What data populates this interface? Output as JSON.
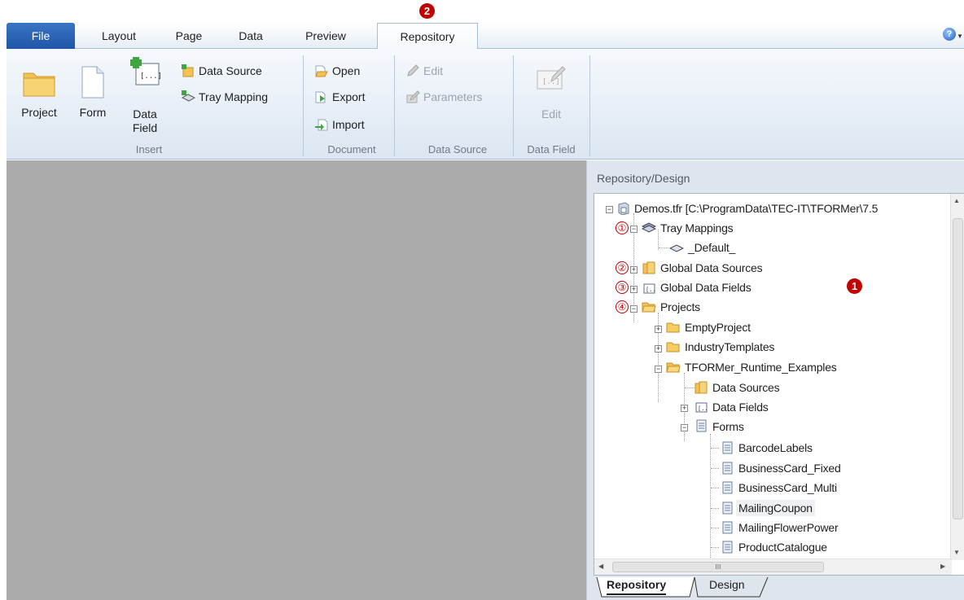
{
  "ribbon": {
    "tabs": [
      "File",
      "Layout",
      "Page",
      "Data",
      "Preview",
      "Repository"
    ],
    "active_tab": "Repository",
    "groups": {
      "insert": {
        "label": "Insert",
        "project": "Project",
        "form": "Form",
        "data_field": "Data\nField",
        "data_source": "Data Source",
        "tray_mapping": "Tray Mapping"
      },
      "document": {
        "label": "Document",
        "open": "Open",
        "export": "Export",
        "import": "Import"
      },
      "data_source": {
        "label": "Data Source",
        "edit": "Edit",
        "parameters": "Parameters"
      },
      "data_field": {
        "label": "Data Field",
        "edit": "Edit"
      }
    }
  },
  "panel": {
    "title": "Repository/Design",
    "tree": {
      "root": "Demos.tfr [C:\\ProgramData\\TEC-IT\\TFORMer\\7.5",
      "tray_mappings": "Tray Mappings",
      "default": "_Default_",
      "global_data_sources": "Global Data Sources",
      "global_data_fields": "Global Data Fields",
      "projects": "Projects",
      "empty_project": "EmptyProject",
      "industry_templates": "IndustryTemplates",
      "runtime_examples": "TFORMer_Runtime_Examples",
      "data_sources": "Data Sources",
      "data_fields": "Data Fields",
      "forms": "Forms",
      "form_items": [
        "BarcodeLabels",
        "BusinessCard_Fixed",
        "BusinessCard_Multi",
        "MailingCoupon",
        "MailingFlowerPower",
        "ProductCatalogue"
      ]
    },
    "bottom_tabs": [
      "Repository",
      "Design"
    ],
    "hscroll_grip": "III"
  },
  "annotations": {
    "circled": [
      "①",
      "②",
      "③",
      "④"
    ],
    "callout_1": "1",
    "callout_2": "2"
  },
  "colors": {
    "callout_red": "#c00000",
    "file_tab_blue": "#1e56a8",
    "workspace_gray": "#ababab"
  },
  "icons": [
    "folder-icon",
    "form-icon",
    "data-field-icon",
    "data-source-icon",
    "tray-mapping-icon",
    "open-icon",
    "export-icon",
    "import-icon",
    "edit-icon",
    "parameters-icon",
    "help-icon",
    "repository-icon",
    "tray-icon",
    "document-icon"
  ]
}
